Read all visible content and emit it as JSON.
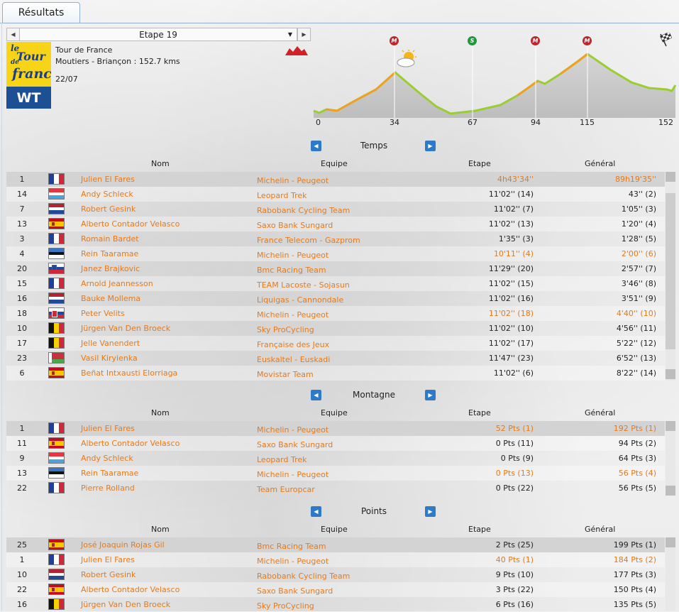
{
  "tab": {
    "label": "Résultats"
  },
  "stage": {
    "selector_label": "Etape 19",
    "race": "Tour de France",
    "route": "Moutiers - Briançon : 152.7 kms",
    "date": "22/07",
    "category": "WT",
    "logo_text": "le Tour de France"
  },
  "profile": {
    "km_labels": [
      "0",
      "34",
      "67",
      "94",
      "115",
      "152"
    ],
    "markers": [
      {
        "type": "M",
        "km": 34,
        "color": "#c0262c"
      },
      {
        "type": "S",
        "km": 67,
        "color": "#1f9a3a"
      },
      {
        "type": "M",
        "km": 94,
        "color": "#c0262c"
      },
      {
        "type": "M",
        "km": 115,
        "color": "#c0262c"
      }
    ],
    "weather_icon": "sun-cloud-icon",
    "finish_icon": "checkered-flag-icon"
  },
  "columns": {
    "name": "Nom",
    "team": "Equipe",
    "stage": "Etape",
    "general": "Général"
  },
  "temps": {
    "title": "Temps",
    "rows": [
      {
        "pos": "1",
        "flag": "fr",
        "name": "Julien El Fares",
        "team": "Michelin - Peugeot",
        "etape": "4h43'34''",
        "general": "89h19'35''",
        "hl": true,
        "orange": true
      },
      {
        "pos": "14",
        "flag": "lu",
        "name": "Andy Schleck",
        "team": "Leopard Trek",
        "etape": "11'02'' (14)",
        "general": "43'' (2)"
      },
      {
        "pos": "7",
        "flag": "nl",
        "name": "Robert Gesink",
        "team": "Rabobank Cycling Team",
        "etape": "11'02'' (7)",
        "general": "1'05'' (3)"
      },
      {
        "pos": "13",
        "flag": "es",
        "name": "Alberto Contador Velasco",
        "team": "Saxo Bank Sungard",
        "etape": "11'02'' (13)",
        "general": "1'20'' (4)"
      },
      {
        "pos": "3",
        "flag": "fr",
        "name": "Romain Bardet",
        "team": "France Telecom - Gazprom",
        "etape": "1'35'' (3)",
        "general": "1'28'' (5)"
      },
      {
        "pos": "4",
        "flag": "ee",
        "name": "Rein Taaramae",
        "team": "Michelin - Peugeot",
        "etape": "10'11'' (4)",
        "general": "2'00'' (6)",
        "orange": true
      },
      {
        "pos": "20",
        "flag": "si",
        "name": "Janez Brajkovic",
        "team": "Bmc Racing Team",
        "etape": "11'29'' (20)",
        "general": "2'57'' (7)"
      },
      {
        "pos": "15",
        "flag": "fr",
        "name": "Arnold Jeannesson",
        "team": "TEAM Lacoste - Sojasun",
        "etape": "11'02'' (15)",
        "general": "3'46'' (8)"
      },
      {
        "pos": "16",
        "flag": "nl",
        "name": "Bauke Mollema",
        "team": "Liquigas - Cannondale",
        "etape": "11'02'' (16)",
        "general": "3'51'' (9)"
      },
      {
        "pos": "18",
        "flag": "sk",
        "name": "Peter Velits",
        "team": "Michelin - Peugeot",
        "etape": "11'02'' (18)",
        "general": "4'40'' (10)",
        "orange": true
      },
      {
        "pos": "10",
        "flag": "be",
        "name": "Jürgen Van Den Broeck",
        "team": "Sky ProCycling",
        "etape": "11'02'' (10)",
        "general": "4'56'' (11)"
      },
      {
        "pos": "17",
        "flag": "be",
        "name": "Jelle Vanendert",
        "team": "Française des Jeux",
        "etape": "11'02'' (17)",
        "general": "5'22'' (12)"
      },
      {
        "pos": "23",
        "flag": "by",
        "name": "Vasil Kiryienka",
        "team": "Euskaltel - Euskadi",
        "etape": "11'47'' (23)",
        "general": "6'52'' (13)"
      },
      {
        "pos": "6",
        "flag": "es",
        "name": "Beñat Intxausti Elorriaga",
        "team": "Movistar Team",
        "etape": "11'02'' (6)",
        "general": "8'22'' (14)"
      }
    ]
  },
  "montagne": {
    "title": "Montagne",
    "rows": [
      {
        "pos": "1",
        "flag": "fr",
        "name": "Julien El Fares",
        "team": "Michelin - Peugeot",
        "etape": "52 Pts (1)",
        "general": "192 Pts (1)",
        "hl": true,
        "orange": true
      },
      {
        "pos": "11",
        "flag": "es",
        "name": "Alberto Contador Velasco",
        "team": "Saxo Bank Sungard",
        "etape": "0 Pts (11)",
        "general": "94 Pts (2)"
      },
      {
        "pos": "9",
        "flag": "lu",
        "name": "Andy Schleck",
        "team": "Leopard Trek",
        "etape": "0 Pts (9)",
        "general": "64 Pts (3)"
      },
      {
        "pos": "13",
        "flag": "ee",
        "name": "Rein Taaramae",
        "team": "Michelin - Peugeot",
        "etape": "0 Pts (13)",
        "general": "56 Pts (4)",
        "orange": true
      },
      {
        "pos": "22",
        "flag": "fr",
        "name": "Pierre Rolland",
        "team": "Team Europcar",
        "etape": "0 Pts (22)",
        "general": "56 Pts (5)"
      }
    ]
  },
  "points": {
    "title": "Points",
    "rows": [
      {
        "pos": "25",
        "flag": "es",
        "name": "José Joaquin Rojas Gil",
        "team": "Bmc Racing Team",
        "etape": "2 Pts (25)",
        "general": "199 Pts (1)",
        "hl": true
      },
      {
        "pos": "1",
        "flag": "fr",
        "name": "Julien El Fares",
        "team": "Michelin - Peugeot",
        "etape": "40 Pts (1)",
        "general": "184 Pts (2)",
        "orange": true
      },
      {
        "pos": "10",
        "flag": "nl",
        "name": "Robert Gesink",
        "team": "Rabobank Cycling Team",
        "etape": "9 Pts (10)",
        "general": "177 Pts (3)"
      },
      {
        "pos": "22",
        "flag": "es",
        "name": "Alberto Contador Velasco",
        "team": "Saxo Bank Sungard",
        "etape": "3 Pts (22)",
        "general": "150 Pts (4)"
      },
      {
        "pos": "16",
        "flag": "be",
        "name": "Jürgen Van Den Broeck",
        "team": "Sky ProCycling",
        "etape": "6 Pts (16)",
        "general": "135 Pts (5)"
      }
    ]
  },
  "colors": {
    "accent": "#e57a1c",
    "nav": "#2f79c9",
    "highlight_row": "#d3d3d3"
  }
}
